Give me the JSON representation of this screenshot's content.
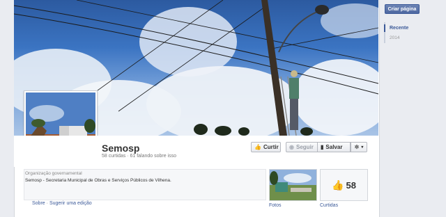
{
  "page": {
    "name": "Semosp",
    "stats": "58 curtidas · 61 falando sobre isso",
    "category": "Organização governamental",
    "description": "Semosp - Secretaria Municipal de Obras e Serviços Públicos de Vilhena."
  },
  "actions": {
    "like_label": "Curtir",
    "follow_label": "Seguir",
    "save_label": "Salvar",
    "more_label": "▾"
  },
  "links": {
    "about": "Sobre",
    "separator": "·",
    "suggest_edit": "Sugerir uma edição"
  },
  "tiles": {
    "photos_label": "Fotos",
    "likes_label": "Curtidas",
    "likes_count": "58"
  },
  "sidebar": {
    "create_page": "Criar página",
    "timeline_recent": "Recente",
    "timeline_year": "2014"
  },
  "colors": {
    "link": "#3b5998",
    "sky": "#3b74c2"
  }
}
